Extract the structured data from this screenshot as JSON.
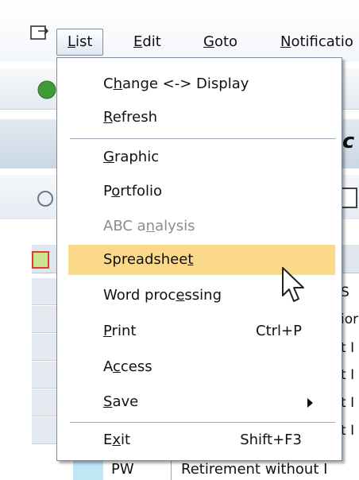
{
  "menubar": {
    "items": [
      {
        "pre": "",
        "ul": "L",
        "post": "ist"
      },
      {
        "pre": "",
        "ul": "E",
        "post": "dit"
      },
      {
        "pre": "",
        "ul": "G",
        "post": "oto"
      },
      {
        "pre": "",
        "ul": "N",
        "post": "otificatio"
      }
    ]
  },
  "background": {
    "title_fragment": "ic",
    "grid_fragments": [
      "S",
      "ior",
      "t I",
      "t I",
      "t I",
      "t I"
    ],
    "last_row": {
      "code": "PW",
      "description": "Retirement without I"
    }
  },
  "dropdown": {
    "items": [
      {
        "pre": "C",
        "ul": "h",
        "post": "ange <-> Display",
        "shortcut": "",
        "disabled": false
      },
      {
        "pre": "",
        "ul": "R",
        "post": "efresh",
        "shortcut": "",
        "disabled": false
      },
      {
        "pre": "",
        "ul": "G",
        "post": "raphic",
        "shortcut": "",
        "disabled": false
      },
      {
        "pre": "P",
        "ul": "o",
        "post": "rtfolio",
        "shortcut": "",
        "disabled": false
      },
      {
        "pre": "ABC a",
        "ul": "n",
        "post": "alysis",
        "shortcut": "",
        "disabled": true
      },
      {
        "pre": "Spreadshee",
        "ul": "t",
        "post": "",
        "shortcut": "",
        "disabled": false,
        "highlighted": true
      },
      {
        "pre": "Word proc",
        "ul": "e",
        "post": "ssing",
        "shortcut": "",
        "disabled": false
      },
      {
        "pre": "",
        "ul": "P",
        "post": "rint",
        "shortcut": "Ctrl+P",
        "disabled": false
      },
      {
        "pre": "A",
        "ul": "c",
        "post": "cess",
        "shortcut": "",
        "disabled": false
      },
      {
        "pre": "",
        "ul": "S",
        "post": "ave",
        "shortcut": "",
        "disabled": false,
        "submenu": true
      },
      {
        "pre": "E",
        "ul": "x",
        "post": "it",
        "shortcut": "Shift+F3",
        "disabled": false
      }
    ]
  },
  "colors": {
    "highlight": "#fbd98a",
    "disabled_text": "#8c8c8c",
    "menu_border": "#7d8b9c"
  }
}
